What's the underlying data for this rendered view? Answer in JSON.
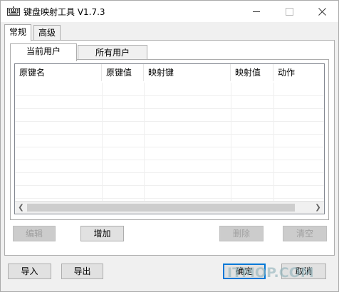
{
  "window": {
    "title": "键盘映射工具 V1.7.3",
    "icon": "keyboard-icon"
  },
  "outer_tabs": [
    {
      "label": "常规",
      "active": true
    },
    {
      "label": "高级",
      "active": false
    }
  ],
  "inner_tabs": [
    {
      "label": "当前用户",
      "active": true
    },
    {
      "label": "所有用户",
      "active": false
    }
  ],
  "table": {
    "columns": [
      "原键名",
      "原键值",
      "映射键",
      "映射值",
      "动作"
    ],
    "rows": []
  },
  "actions": {
    "edit": "编辑",
    "add": "增加",
    "delete": "删除",
    "clear": "清空"
  },
  "footer": {
    "import": "导入",
    "export": "导出",
    "ok": "确定",
    "cancel": "取消"
  },
  "watermark": "ITMOP.COM"
}
